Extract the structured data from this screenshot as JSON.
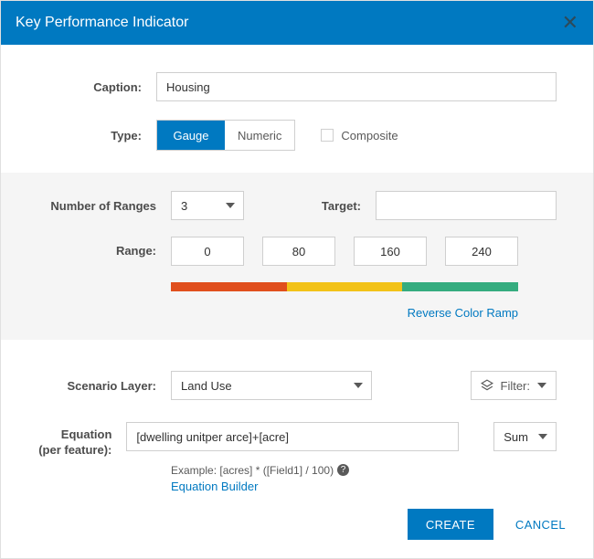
{
  "header": {
    "title": "Key Performance Indicator"
  },
  "labels": {
    "caption": "Caption:",
    "type": "Type:",
    "number_of_ranges": "Number of Ranges",
    "target": "Target:",
    "range": "Range:",
    "scenario_layer": "Scenario Layer:",
    "equation": "Equation (per feature):"
  },
  "values": {
    "caption": "Housing",
    "type_selected": "Gauge",
    "type_options": {
      "gauge": "Gauge",
      "numeric": "Numeric"
    },
    "composite_label": "Composite",
    "composite_checked": false,
    "number_of_ranges": "3",
    "target": "",
    "ranges": [
      "0",
      "80",
      "160",
      "240"
    ],
    "ramp_colors": [
      "#e04f1d",
      "#f2c218",
      "#35ac7f"
    ],
    "reverse_link": "Reverse Color Ramp",
    "scenario_layer": "Land Use",
    "filter_label": "Filter:",
    "equation": "[dwelling unitper arce]+[acre]",
    "aggregation": "Sum",
    "example_text": "Example: [acres] * ([Field1] / 100)",
    "builder_link": "Equation Builder"
  },
  "footer": {
    "create": "CREATE",
    "cancel": "CANCEL"
  }
}
